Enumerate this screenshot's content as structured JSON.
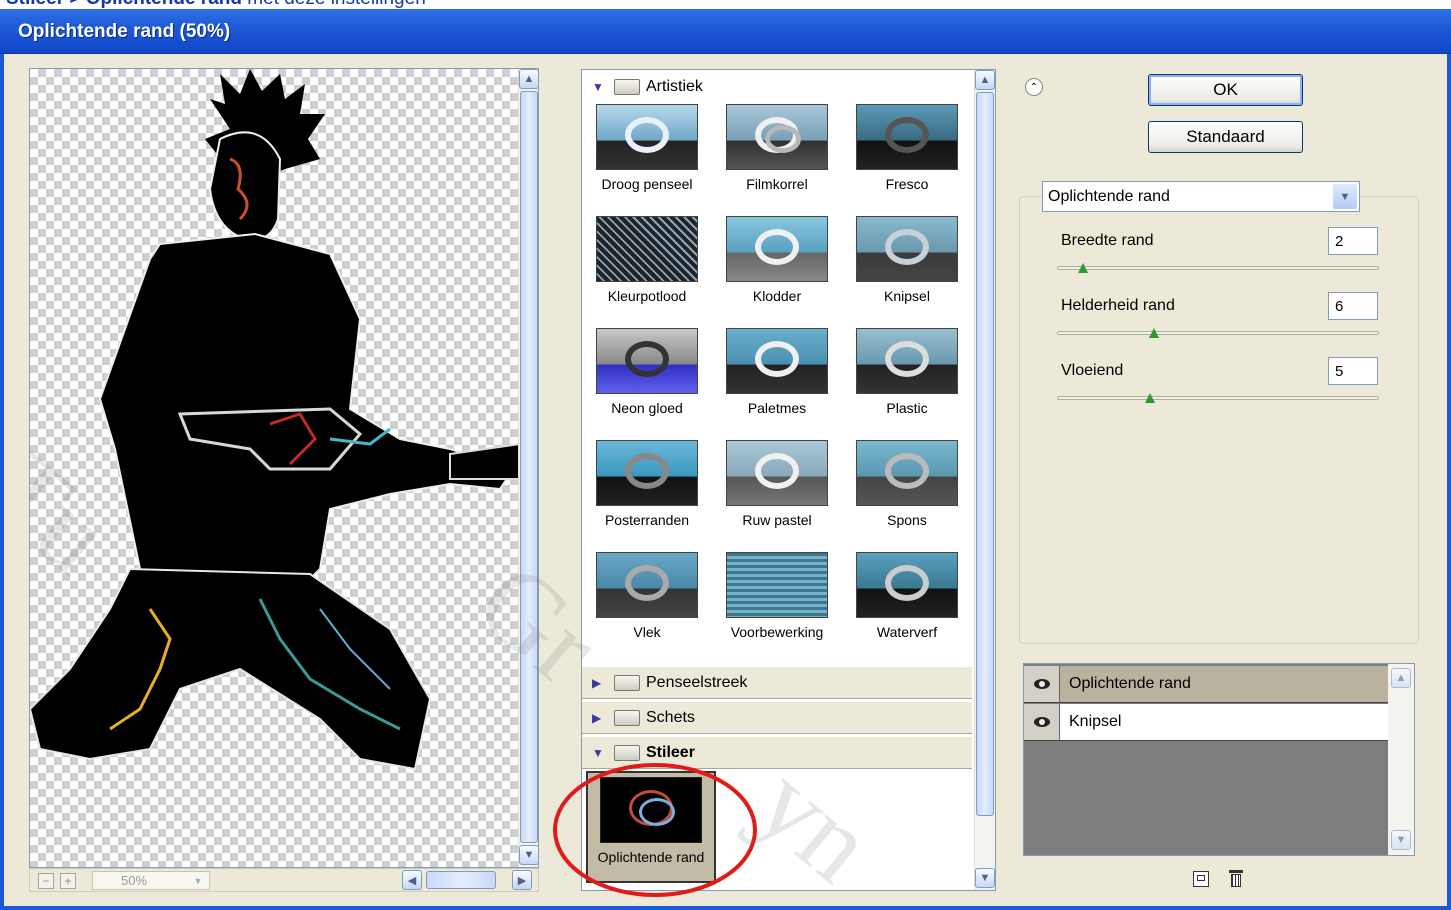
{
  "caption": {
    "bold": "Stileer > Oplichtende rand",
    "rest": " met deze instellingen"
  },
  "window": {
    "title": "Oplichtende rand (50%)"
  },
  "preview": {
    "zoom_value": "50%"
  },
  "gallery": {
    "categories": [
      {
        "name": "Artistiek",
        "expanded": true,
        "filters": [
          "Droog penseel",
          "Filmkorrel",
          "Fresco",
          "Kleurpotlood",
          "Klodder",
          "Knipsel",
          "Neon gloed",
          "Paletmes",
          "Plastic",
          "Posterranden",
          "Ruw pastel",
          "Spons",
          "Vlek",
          "Voorbewerking",
          "Waterverf"
        ]
      },
      {
        "name": "Penseelstreek",
        "expanded": false
      },
      {
        "name": "Schets",
        "expanded": false
      },
      {
        "name": "Stileer",
        "expanded": true,
        "filters": [
          "Oplichtende rand"
        ]
      }
    ]
  },
  "buttons": {
    "ok": "OK",
    "default": "Standaard"
  },
  "settings": {
    "filter_selected": "Oplichtende rand",
    "params": [
      {
        "label": "Breedte rand",
        "value": "2",
        "level": 0.08
      },
      {
        "label": "Helderheid rand",
        "value": "6",
        "level": 0.3
      },
      {
        "label": "Vloeiend",
        "value": "5",
        "level": 0.29
      }
    ]
  },
  "layers": [
    {
      "name": "Oplichtende rand",
      "selected": true
    },
    {
      "name": "Knipsel",
      "selected": false
    }
  ],
  "colors": {
    "title_bar": "#1d58d6",
    "highlight_circle": "#e11a1a",
    "dialog_bg": "#ece9d8"
  }
}
